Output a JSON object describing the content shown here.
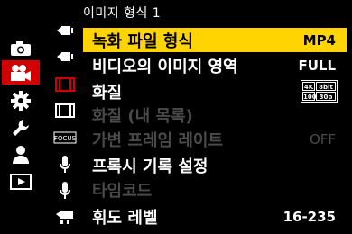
{
  "header": {
    "title": "이미지 형식 1"
  },
  "categories": [
    {
      "name": "camera-icon",
      "active": false
    },
    {
      "name": "video-camera-icon",
      "active": true
    },
    {
      "name": "gear-icon",
      "active": false
    },
    {
      "name": "wrench-icon",
      "active": false
    },
    {
      "name": "user-icon",
      "active": false
    },
    {
      "name": "playback-icon",
      "active": false
    }
  ],
  "subtabs": [
    {
      "name": "video-format-icon"
    },
    {
      "name": "video-format-2-icon"
    },
    {
      "name": "film-icon",
      "active": true
    },
    {
      "name": "film-2-icon"
    },
    {
      "name": "focus-icon"
    },
    {
      "name": "microphone-icon"
    },
    {
      "name": "microphone-2-icon"
    },
    {
      "name": "tripod-camera-icon"
    }
  ],
  "rows": [
    {
      "label": "녹화 파일 형식",
      "value": "MP4",
      "selected": true
    },
    {
      "label": "비디오의 이미지 영역",
      "value": "FULL"
    },
    {
      "label": "화질",
      "chips": [
        "4K",
        "8bit",
        "100M",
        "30p"
      ]
    },
    {
      "label": "화질 (내 목록)",
      "value": "",
      "disabled": true
    },
    {
      "label": "가변 프레임 레이트",
      "value": "OFF",
      "disabled": true
    },
    {
      "label": "프록시 기록 설정",
      "value": ""
    },
    {
      "label": "타임코드",
      "value": "",
      "disabled": true
    },
    {
      "label": "휘도 레벨",
      "value": "16-235"
    }
  ],
  "colors": {
    "selected_bg": "#ffd400",
    "active_tab": "#d20000",
    "disabled": "#4a4a4a"
  }
}
